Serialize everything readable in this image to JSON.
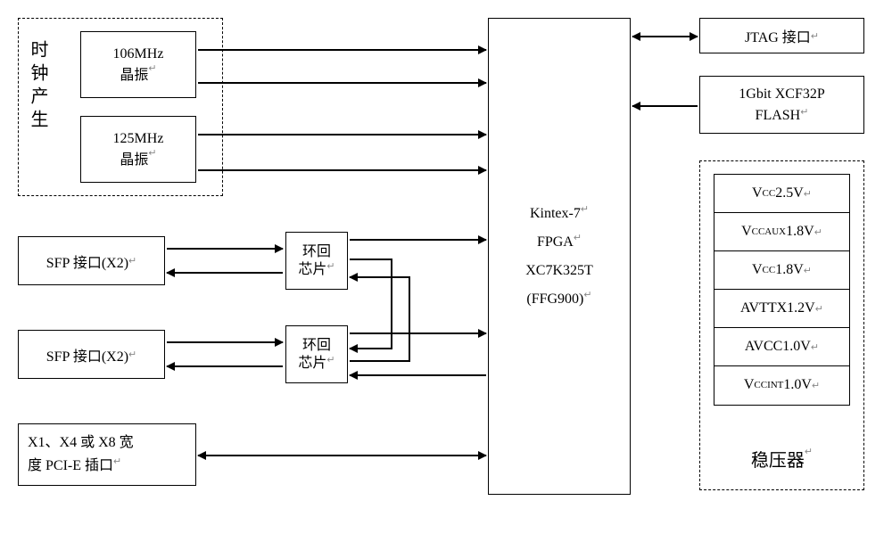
{
  "clock": {
    "label": "时钟产生",
    "osc1": {
      "freq": "106MHz",
      "name": "晶振"
    },
    "osc2": {
      "freq": "125MHz",
      "name": "晶振"
    }
  },
  "sfp1": "SFP 接口(X2)",
  "sfp2": "SFP 接口(X2)",
  "loop1": {
    "l1": "环回",
    "l2": "芯片"
  },
  "loop2": {
    "l1": "环回",
    "l2": "芯片"
  },
  "pcie": {
    "l1": "X1、X4 或 X8 宽",
    "l2": "度 PCI-E 插口"
  },
  "fpga": {
    "l1": "Kintex-7",
    "l2": "FPGA",
    "l3": "XC7K325T",
    "l4": "(FFG900)"
  },
  "jtag": "JTAG 接口",
  "flash": {
    "l1": "1Gbit XCF32P",
    "l2": "FLASH"
  },
  "reg": {
    "label": "稳压器",
    "rows": [
      {
        "pre": "V",
        "sub": "CC",
        "post": "2.5V"
      },
      {
        "pre": "V",
        "sub": "CCAUX",
        "post": "1.8V"
      },
      {
        "pre": "V",
        "sub": "CC",
        "post": "1.8V"
      },
      {
        "pre": "AVTTX1.2V",
        "sub": "",
        "post": ""
      },
      {
        "pre": "AVCC1.0V",
        "sub": "",
        "post": ""
      },
      {
        "pre": "V",
        "sub": "CCINT",
        "post": "1.0V"
      }
    ]
  },
  "chart_data": {
    "type": "table",
    "title": "FPGA board block diagram",
    "components": [
      "106MHz 晶振",
      "125MHz 晶振",
      "SFP 接口(X2)",
      "SFP 接口(X2)",
      "环回芯片",
      "环回芯片",
      "X1/X4/X8 PCI-E 插口",
      "Kintex-7 FPGA XC7K325T (FFG900)",
      "JTAG 接口",
      "1Gbit XCF32P FLASH",
      "稳压器"
    ],
    "voltages": [
      "VCC 2.5V",
      "VCCAUX 1.8V",
      "VCC 1.8V",
      "AVTTX 1.2V",
      "AVCC 1.0V",
      "VCCINT 1.0V"
    ]
  }
}
